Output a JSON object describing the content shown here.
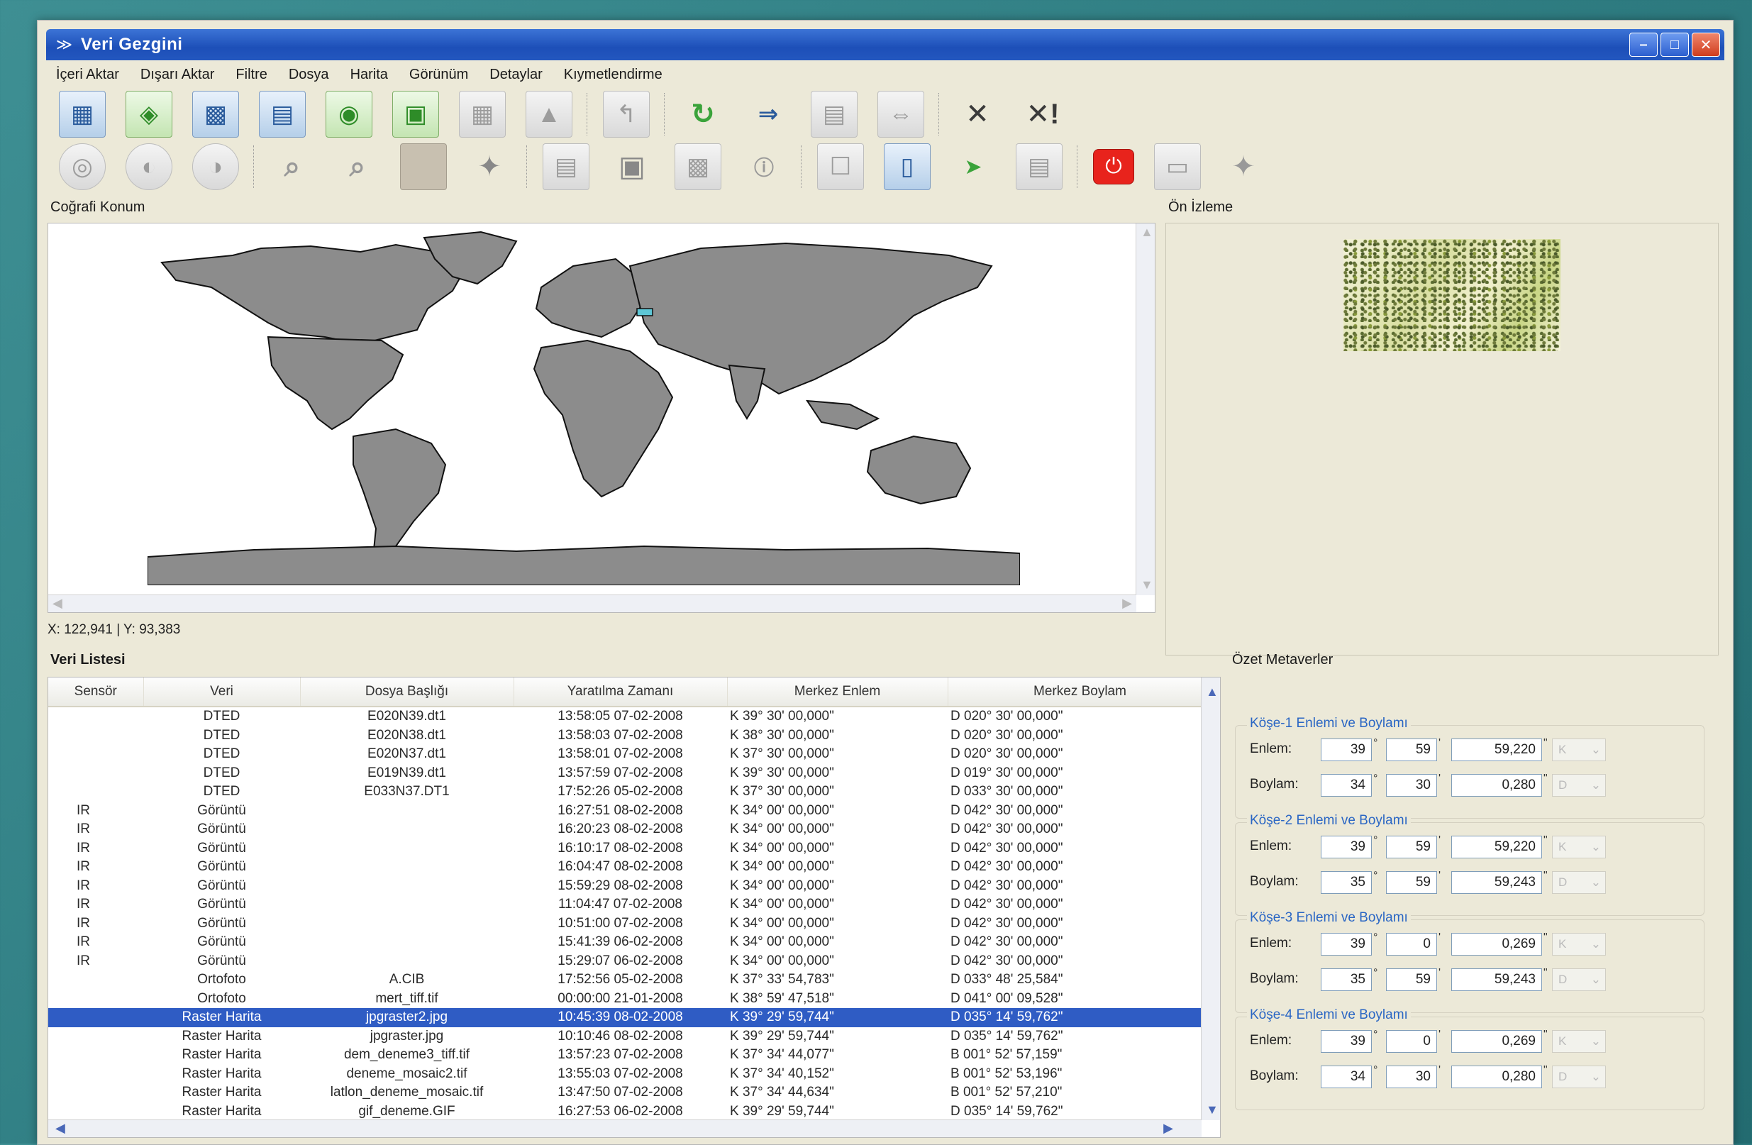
{
  "window": {
    "title": "Veri Gezgini"
  },
  "menu": [
    "İçeri Aktar",
    "Dışarı Aktar",
    "Filtre",
    "Dosya",
    "Harita",
    "Görünüm",
    "Detaylar",
    "Kıymetlendirme"
  ],
  "toolbar1": {
    "icons": [
      "import-table-icon",
      "import-map-icon",
      "import-image-icon",
      "import-layer-icon",
      "import-points-icon",
      "import-raster-icon",
      "export-disabled-icon",
      "export-map-disabled-icon",
      "folder-up-icon",
      "refresh-icon",
      "merge-right-icon",
      "align-center-icon",
      "split-icon",
      "delete-icon",
      "delete-all-icon"
    ],
    "glyphs": {
      "delete": "✕",
      "delete_all": "✕!"
    }
  },
  "toolbar2": {
    "icons": [
      "globe-icon",
      "globe-rotate-icon",
      "globe-alt-icon",
      "zoom-in-icon",
      "zoom-out-icon",
      "color-fill-icon",
      "pan-icon",
      "document-icon",
      "camera-icon",
      "image-icon",
      "info-icon",
      "tooltip-icon",
      "page-icon",
      "select-arrow-icon",
      "select-area-icon",
      "power-icon",
      "eraser-icon",
      "center-icon"
    ]
  },
  "panels": {
    "map_title": "Coğrafi Konum",
    "preview_title": "Ön İzleme",
    "list_title": "Veri Listesi",
    "meta_title": "Özet Metaverler"
  },
  "coord_readout": "X: 122,941 | Y: 93,383",
  "table": {
    "headers": [
      "Sensör",
      "Veri",
      "Dosya Başlığı",
      "Yaratılma Zamanı",
      "Merkez Enlem",
      "Merkez Boylam"
    ],
    "rows": [
      {
        "s": "",
        "v": "DTED",
        "d": "E020N39.dt1",
        "z": "13:58:05 07-02-2008",
        "e": "K  39°  30'  00,000\"",
        "b": "D  020°  30'  00,000\""
      },
      {
        "s": "",
        "v": "DTED",
        "d": "E020N38.dt1",
        "z": "13:58:03 07-02-2008",
        "e": "K  38°  30'  00,000\"",
        "b": "D  020°  30'  00,000\""
      },
      {
        "s": "",
        "v": "DTED",
        "d": "E020N37.dt1",
        "z": "13:58:01 07-02-2008",
        "e": "K  37°  30'  00,000\"",
        "b": "D  020°  30'  00,000\""
      },
      {
        "s": "",
        "v": "DTED",
        "d": "E019N39.dt1",
        "z": "13:57:59 07-02-2008",
        "e": "K  39°  30'  00,000\"",
        "b": "D  019°  30'  00,000\""
      },
      {
        "s": "",
        "v": "DTED",
        "d": "E033N37.DT1",
        "z": "17:52:26 05-02-2008",
        "e": "K  37°  30'  00,000\"",
        "b": "D  033°  30'  00,000\""
      },
      {
        "s": "IR",
        "v": "Görüntü",
        "d": "",
        "z": "16:27:51 08-02-2008",
        "e": "K  34°  00'  00,000\"",
        "b": "D  042°  30'  00,000\""
      },
      {
        "s": "IR",
        "v": "Görüntü",
        "d": "",
        "z": "16:20:23 08-02-2008",
        "e": "K  34°  00'  00,000\"",
        "b": "D  042°  30'  00,000\""
      },
      {
        "s": "IR",
        "v": "Görüntü",
        "d": "",
        "z": "16:10:17 08-02-2008",
        "e": "K  34°  00'  00,000\"",
        "b": "D  042°  30'  00,000\""
      },
      {
        "s": "IR",
        "v": "Görüntü",
        "d": "",
        "z": "16:04:47 08-02-2008",
        "e": "K  34°  00'  00,000\"",
        "b": "D  042°  30'  00,000\""
      },
      {
        "s": "IR",
        "v": "Görüntü",
        "d": "",
        "z": "15:59:29 08-02-2008",
        "e": "K  34°  00'  00,000\"",
        "b": "D  042°  30'  00,000\""
      },
      {
        "s": "IR",
        "v": "Görüntü",
        "d": "",
        "z": "11:04:47 07-02-2008",
        "e": "K  34°  00'  00,000\"",
        "b": "D  042°  30'  00,000\""
      },
      {
        "s": "IR",
        "v": "Görüntü",
        "d": "",
        "z": "10:51:00 07-02-2008",
        "e": "K  34°  00'  00,000\"",
        "b": "D  042°  30'  00,000\""
      },
      {
        "s": "IR",
        "v": "Görüntü",
        "d": "",
        "z": "15:41:39 06-02-2008",
        "e": "K  34°  00'  00,000\"",
        "b": "D  042°  30'  00,000\""
      },
      {
        "s": "IR",
        "v": "Görüntü",
        "d": "",
        "z": "15:29:07 06-02-2008",
        "e": "K  34°  00'  00,000\"",
        "b": "D  042°  30'  00,000\""
      },
      {
        "s": "",
        "v": "Ortofoto",
        "d": "A.CIB",
        "z": "17:52:56 05-02-2008",
        "e": "K  37°  33'  54,783\"",
        "b": "D  033°  48'  25,584\""
      },
      {
        "s": "",
        "v": "Ortofoto",
        "d": "mert_tiff.tif",
        "z": "00:00:00 21-01-2008",
        "e": "K  38°  59'  47,518\"",
        "b": "D  041°  00'  09,528\""
      },
      {
        "s": "",
        "v": "Raster Harita",
        "d": "jpgraster2.jpg",
        "z": "10:45:39 08-02-2008",
        "e": "K  39°  29'  59,744\"",
        "b": "D  035°  14'  59,762\"",
        "sel": true
      },
      {
        "s": "",
        "v": "Raster Harita",
        "d": "jpgraster.jpg",
        "z": "10:10:46 08-02-2008",
        "e": "K  39°  29'  59,744\"",
        "b": "D  035°  14'  59,762\""
      },
      {
        "s": "",
        "v": "Raster Harita",
        "d": "dem_deneme3_tiff.tif",
        "z": "13:57:23 07-02-2008",
        "e": "K  37°  34'  44,077\"",
        "b": "B  001°  52'  57,159\""
      },
      {
        "s": "",
        "v": "Raster Harita",
        "d": "deneme_mosaic2.tif",
        "z": "13:55:03 07-02-2008",
        "e": "K  37°  34'  40,152\"",
        "b": "B  001°  52'  53,196\""
      },
      {
        "s": "",
        "v": "Raster Harita",
        "d": "latlon_deneme_mosaic.tif",
        "z": "13:47:50 07-02-2008",
        "e": "K  37°  34'  44,634\"",
        "b": "B  001°  52'  57,210\""
      },
      {
        "s": "",
        "v": "Raster Harita",
        "d": "gif_deneme.GIF",
        "z": "16:27:53 06-02-2008",
        "e": "K  39°  29'  59,744\"",
        "b": "D  035°  14'  59,762\""
      }
    ]
  },
  "meta": {
    "labels": {
      "lat": "Enlem:",
      "lon": "Boylam:",
      "deg": "°",
      "min": "'",
      "sec": "\""
    },
    "groups": [
      {
        "title": "Köşe-1 Enlemi ve Boylamı",
        "lat": [
          "39",
          "59",
          "59,220",
          "K"
        ],
        "lon": [
          "34",
          "30",
          "0,280",
          "D"
        ]
      },
      {
        "title": "Köşe-2 Enlemi ve Boylamı",
        "lat": [
          "39",
          "59",
          "59,220",
          "K"
        ],
        "lon": [
          "35",
          "59",
          "59,243",
          "D"
        ]
      },
      {
        "title": "Köşe-3 Enlemi ve Boylamı",
        "lat": [
          "39",
          "0",
          "0,269",
          "K"
        ],
        "lon": [
          "35",
          "59",
          "59,243",
          "D"
        ]
      },
      {
        "title": "Köşe-4 Enlemi ve Boylamı",
        "lat": [
          "39",
          "0",
          "0,269",
          "K"
        ],
        "lon": [
          "34",
          "30",
          "0,280",
          "D"
        ]
      }
    ]
  },
  "colors": {
    "selection": "#2f5cc4",
    "land": "#8c8c8c",
    "titlebar": "#1d4fb8"
  }
}
